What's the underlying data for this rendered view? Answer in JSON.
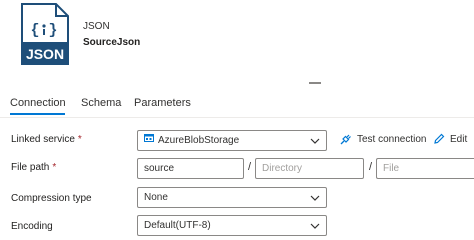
{
  "header": {
    "icon_text": "JSON",
    "dataset_type": "JSON",
    "dataset_name": "SourceJson"
  },
  "tabs": [
    {
      "label": "Connection",
      "active": true
    },
    {
      "label": "Schema",
      "active": false
    },
    {
      "label": "Parameters",
      "active": false
    }
  ],
  "form": {
    "linked_service": {
      "label": "Linked service",
      "required_mark": "*",
      "value": "AzureBlobStorage",
      "test_connection_label": "Test connection",
      "edit_label": "Edit"
    },
    "file_path": {
      "label": "File path",
      "required_mark": "*",
      "container_value": "source",
      "separator": "/",
      "directory_placeholder": "Directory",
      "file_placeholder": "File"
    },
    "compression_type": {
      "label": "Compression type",
      "value": "None"
    },
    "encoding": {
      "label": "Encoding",
      "value": "Default(UTF-8)"
    }
  },
  "colors": {
    "accent": "#0078d4",
    "icon_blue": "#1e4e79",
    "required": "#a4262c"
  }
}
